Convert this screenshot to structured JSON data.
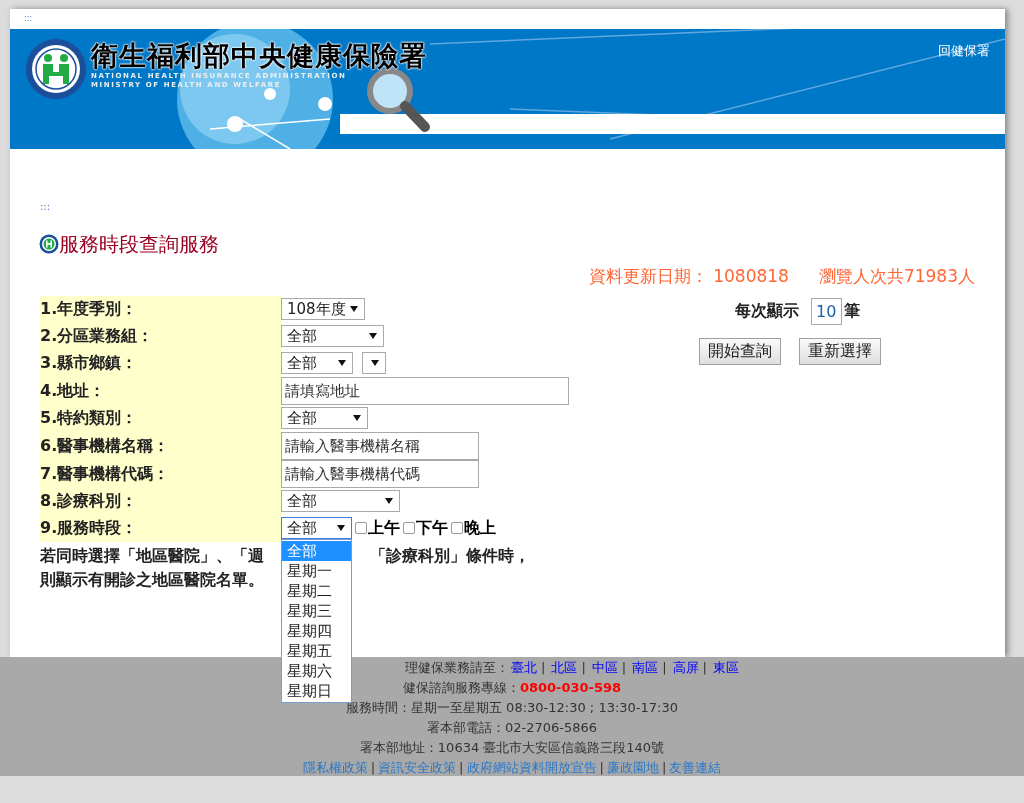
{
  "skip_link_top": ":::",
  "banner": {
    "title": "衛生福利部中央健康保險署",
    "subtitle_lines": [
      "NATIONAL HEALTH INSURANCE ADMINISTRATION",
      "MINISTRY OF HEALTH AND WELFARE"
    ],
    "home_link": "回健保署"
  },
  "skip_link": ":::",
  "page_title": "服務時段查詢服務",
  "update_info": {
    "date_label": "資料更新日期：",
    "date": "1080818",
    "visits": "瀏覽人次共71983人"
  },
  "form": {
    "fields": [
      {
        "label": "1.年度季別：",
        "kind": "select",
        "value": "108年度"
      },
      {
        "label": "2.分區業務組：",
        "kind": "select",
        "value": "全部"
      },
      {
        "label": "3.縣市鄉鎮：",
        "kind": "select_pair",
        "value": "全部"
      },
      {
        "label": "4.地址：",
        "kind": "text",
        "placeholder": "請填寫地址"
      },
      {
        "label": "5.特約類別：",
        "kind": "select",
        "value": "全部"
      },
      {
        "label": "6.醫事機構名稱：",
        "kind": "text",
        "placeholder": "請輸入醫事機構名稱"
      },
      {
        "label": "7.醫事機構代碼：",
        "kind": "text",
        "placeholder": "請輸入醫事機構代碼"
      },
      {
        "label": "8.診療科別：",
        "kind": "select",
        "value": "全部"
      },
      {
        "label": "9.服務時段：",
        "kind": "select_checks",
        "value": "全部",
        "expanded": true,
        "options": [
          {
            "label": "全部",
            "selected": true
          },
          {
            "label": "星期一",
            "selected": false
          },
          {
            "label": "星期二",
            "selected": false
          },
          {
            "label": "星期三",
            "selected": false
          },
          {
            "label": "星期四",
            "selected": false
          },
          {
            "label": "星期五",
            "selected": false
          },
          {
            "label": "星期六",
            "selected": false
          },
          {
            "label": "星期日",
            "selected": false
          }
        ],
        "checks": [
          {
            "label": "上午",
            "checked": false
          },
          {
            "label": "下午",
            "checked": false
          },
          {
            "label": "晚上",
            "checked": false
          }
        ]
      }
    ]
  },
  "note": {
    "line_1_left": "若同時選擇「地區醫院」、「週",
    "line_1_right": "「診療科別」條件時，",
    "line_2": "則顯示有開診之地區醫院名單。"
  },
  "page_size": {
    "label": "每次顯示",
    "value": "10",
    "unit": "筆"
  },
  "buttons": [
    "開始查詢",
    "重新選擇"
  ],
  "footer": {
    "separator": "|",
    "region_label": "理健保業務請至：",
    "region_links": [
      "臺北",
      "北區",
      "中區",
      "南區",
      "高屏",
      "東區"
    ],
    "hotline_label": "健保諮詢服務專線：",
    "hotline": "0800-030-598",
    "lines": [
      "服務時間：星期一至星期五 08:30-12:30 ; 13:30-17:30",
      "署本部電話：02-2706-5866",
      "署本部地址：10634 臺北市大安區信義路三段140號"
    ],
    "policy_links": [
      "隱私權政策",
      "資訊安全政策",
      "政府網站資料開放宣告",
      "廉政園地",
      "友善連結"
    ]
  }
}
